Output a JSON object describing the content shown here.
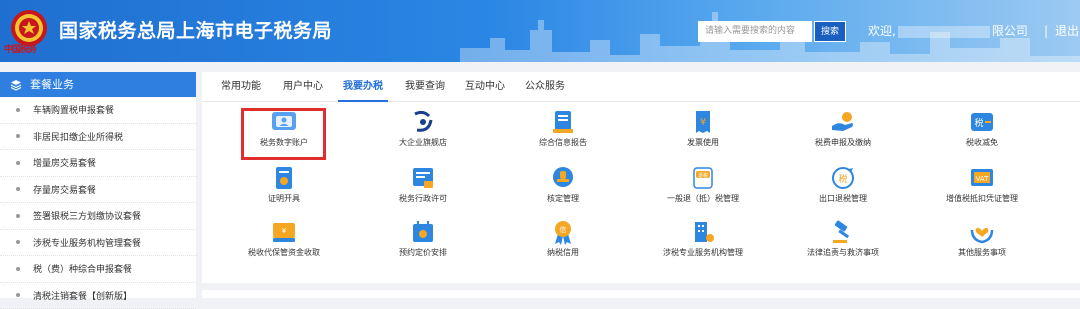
{
  "header": {
    "title": "国家税务总局上海市电子税务局",
    "emblem_text": "中国税务",
    "search_placeholder": "请输入需要搜索的内容",
    "search_button": "搜索",
    "welcome_prefix": "欢迎,",
    "welcome_suffix": "限公司",
    "separator": "|",
    "logout": "退出"
  },
  "sidebar": {
    "title": "套餐业务",
    "items": [
      {
        "label": "车辆购置税申报套餐"
      },
      {
        "label": "非居民扣缴企业所得税"
      },
      {
        "label": "增量房交易套餐"
      },
      {
        "label": "存量房交易套餐"
      },
      {
        "label": "签署银税三方划缴协议套餐"
      },
      {
        "label": "涉税专业服务机构管理套餐"
      },
      {
        "label": "税（费）种综合申报套餐"
      },
      {
        "label": "清税注销套餐【创新版】"
      }
    ]
  },
  "tabs": [
    {
      "label": "常用功能"
    },
    {
      "label": "用户中心"
    },
    {
      "label": "我要办税",
      "active": true
    },
    {
      "label": "我要查询"
    },
    {
      "label": "互动中心"
    },
    {
      "label": "公众服务"
    }
  ],
  "functions": [
    {
      "label": "税务数字账户",
      "icon": "digital-account-icon",
      "highlighted": true
    },
    {
      "label": "大企业旗舰店",
      "icon": "enterprise-logo-icon"
    },
    {
      "label": "综合信息报告",
      "icon": "report-icon"
    },
    {
      "label": "发票使用",
      "icon": "invoice-icon"
    },
    {
      "label": "税费申报及缴纳",
      "icon": "tax-filing-icon"
    },
    {
      "label": "税收减免",
      "icon": "tax-relief-icon"
    },
    {
      "label": "证明开具",
      "icon": "certificate-icon"
    },
    {
      "label": "税务行政许可",
      "icon": "license-icon"
    },
    {
      "label": "核定管理",
      "icon": "stamp-icon"
    },
    {
      "label": "一般退（抵）税管理",
      "icon": "refund-icon"
    },
    {
      "label": "出口退税管理",
      "icon": "export-refund-icon"
    },
    {
      "label": "增值税抵扣凭证管理",
      "icon": "vat-voucher-icon"
    },
    {
      "label": "税收代保管资金收取",
      "icon": "fund-custody-icon"
    },
    {
      "label": "预约定价安排",
      "icon": "pricing-calendar-icon"
    },
    {
      "label": "纳税信用",
      "icon": "credit-medal-icon"
    },
    {
      "label": "涉税专业服务机构管理",
      "icon": "agency-building-icon"
    },
    {
      "label": "法律追责与救济事项",
      "icon": "gavel-icon"
    },
    {
      "label": "其他服务事项",
      "icon": "heart-hands-icon"
    }
  ],
  "colors": {
    "brand": "#2470d8",
    "highlight": "#e02d2d",
    "accent_orange": "#f5a623"
  }
}
